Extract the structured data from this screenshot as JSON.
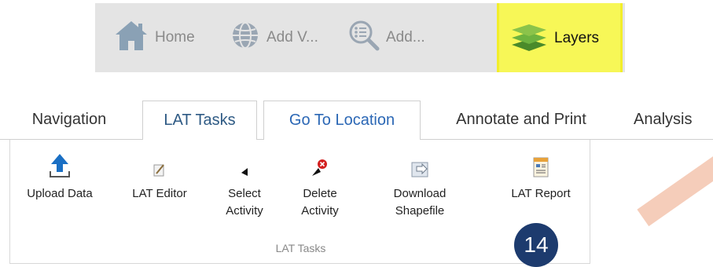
{
  "toolbar": {
    "home_label": "Home",
    "add_v_label": "Add V...",
    "add_label": "Add...",
    "layers_label": "Layers",
    "layers_highlight": "#f7f757"
  },
  "tabs": [
    {
      "label": "Navigation"
    },
    {
      "label": "LAT Tasks",
      "active": true
    },
    {
      "label": "Go To Location",
      "highlight": true
    },
    {
      "label": "Annotate and Print"
    },
    {
      "label": "Analysis"
    }
  ],
  "ribbon": {
    "buttons": [
      {
        "label": "Upload Data",
        "icon": "upload-icon"
      },
      {
        "label": "LAT Editor",
        "icon": "edit-icon"
      },
      {
        "label": "Select\nActivity",
        "icon": "select-arrow-icon"
      },
      {
        "label": "Delete\nActivity",
        "icon": "delete-pin-icon"
      },
      {
        "label": "Download\nShapefile",
        "icon": "download-shapefile-icon"
      },
      {
        "label": "LAT Report",
        "icon": "report-icon"
      }
    ],
    "group_label": "LAT Tasks"
  },
  "badge": {
    "value": "14",
    "color": "#1d3b6e"
  }
}
